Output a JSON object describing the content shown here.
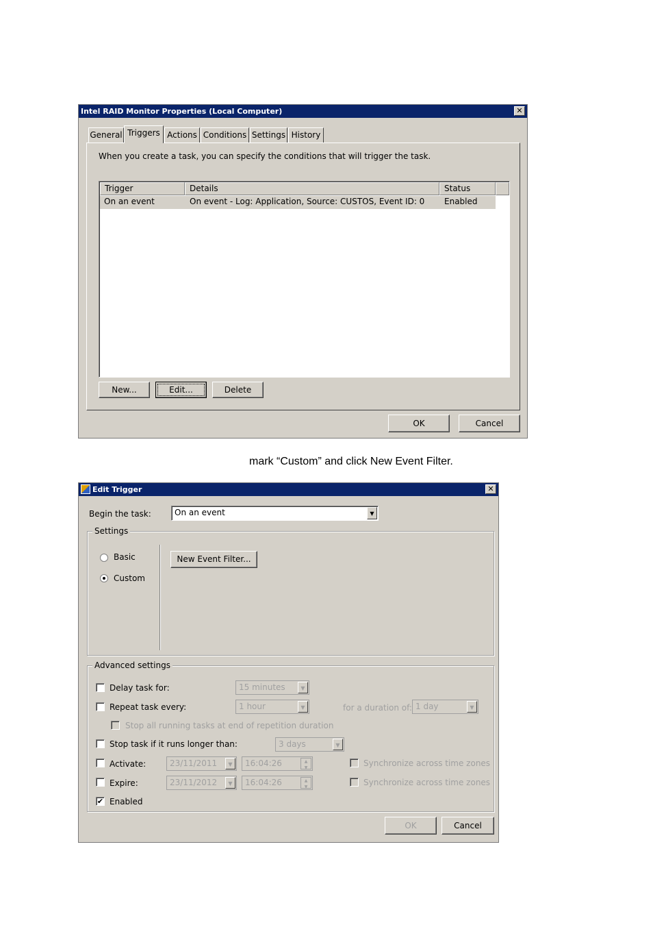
{
  "dialog1": {
    "title": "Intel RAID Monitor Properties (Local Computer)",
    "close_label": "✕",
    "tabs": [
      "General",
      "Triggers",
      "Actions",
      "Conditions",
      "Settings",
      "History"
    ],
    "description": "When you create a task, you can specify the conditions that will trigger the task.",
    "columns": [
      "Trigger",
      "Details",
      "Status"
    ],
    "rows": [
      {
        "trigger": "On an event",
        "details": "On event - Log: Application, Source: CUSTOS, Event ID: 0",
        "status": "Enabled"
      }
    ],
    "new_label": "New...",
    "edit_label": "Edit...",
    "delete_label": "Delete",
    "ok_label": "OK",
    "cancel_label": "Cancel"
  },
  "caption": "mark “Custom” and click New Event Filter.",
  "dialog2": {
    "title": "Edit Trigger",
    "close_label": "✕",
    "begin_label": "Begin the task:",
    "begin_value": "On an event",
    "settings_label": "Settings",
    "basic_label": "Basic",
    "custom_label": "Custom",
    "new_event_filter_label": "New Event Filter...",
    "advanced_label": "Advanced settings",
    "delay_label": "Delay task for:",
    "delay_value": "15 minutes",
    "repeat_label": "Repeat task every:",
    "repeat_value": "1 hour",
    "duration_label": "for a duration of:",
    "duration_value": "1 day",
    "stop_all_label": "Stop all running tasks at end of repetition duration",
    "stop_longer_label": "Stop task if it runs longer than:",
    "stop_longer_value": "3 days",
    "activate_label": "Activate:",
    "activate_date": "23/11/2011",
    "activate_time": "16:04:26",
    "expire_label": "Expire:",
    "expire_date": "23/11/2012",
    "expire_time": "16:04:26",
    "sync_label": "Synchronize across time zones",
    "enabled_label": "Enabled",
    "ok_label": "OK",
    "cancel_label": "Cancel"
  },
  "colors": {
    "titlebar": "#0a246a",
    "face": "#d4d0c8",
    "disabled_text": "#a0a0a0"
  }
}
